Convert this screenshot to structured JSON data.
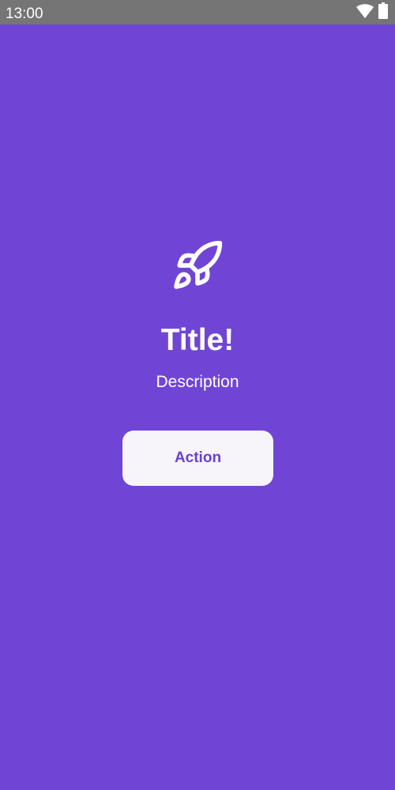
{
  "status_bar": {
    "time": "13:00",
    "icons": [
      "wifi-icon",
      "battery-icon"
    ]
  },
  "main": {
    "icon": "rocket-icon",
    "title": "Title!",
    "description": "Description",
    "action_label": "Action"
  },
  "colors": {
    "background": "#7045D6",
    "status_bar": "#757575",
    "button_background": "#F7F5FA",
    "button_text": "#6A3FD0",
    "text": "#FFFFFF"
  }
}
